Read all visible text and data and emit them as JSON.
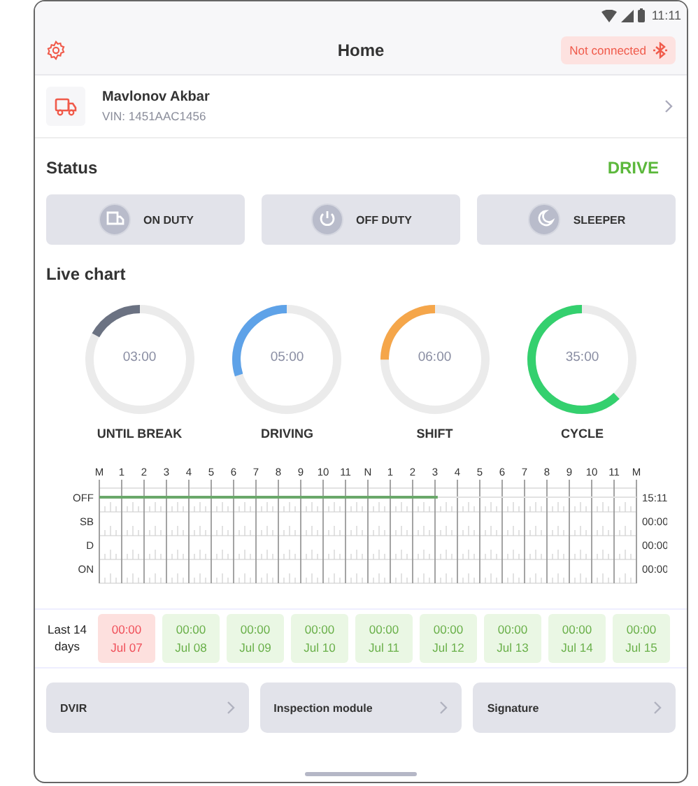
{
  "status_bar": {
    "time": "11:11"
  },
  "header": {
    "title": "Home",
    "connection": {
      "label": "Not connected",
      "connected": false
    }
  },
  "driver": {
    "name": "Mavlonov Akbar",
    "vin": "VIN: 1451AAC1456"
  },
  "status": {
    "title": "Status",
    "current": "DRIVE",
    "buttons": [
      {
        "label": "ON DUTY",
        "selected": false
      },
      {
        "label": "OFF DUTY",
        "selected": false
      },
      {
        "label": "SLEEPER",
        "selected": false
      }
    ]
  },
  "live_chart": {
    "title": "Live chart",
    "gauges": [
      {
        "value": "03:00",
        "label": "UNTIL BREAK",
        "level": 0.17,
        "color": "#6b7282"
      },
      {
        "value": "05:00",
        "label": "DRIVING",
        "level": 0.3,
        "color": "#5ea2e8"
      },
      {
        "value": "06:00",
        "label": "SHIFT",
        "level": 0.25,
        "color": "#f5a64a"
      },
      {
        "value": "35:00",
        "label": "CYCLE",
        "level": 0.62,
        "color": "#34d06e"
      }
    ]
  },
  "log": {
    "hour_labels": [
      "M",
      "1",
      "2",
      "3",
      "4",
      "5",
      "6",
      "7",
      "8",
      "9",
      "10",
      "11",
      "N",
      "1",
      "2",
      "3",
      "4",
      "5",
      "6",
      "7",
      "8",
      "9",
      "10",
      "11",
      "M"
    ],
    "rows": [
      {
        "label": "OFF",
        "total": "15:11",
        "level": 0.63
      },
      {
        "label": "SB",
        "total": "00:00"
      },
      {
        "label": "D",
        "total": "00:00"
      },
      {
        "label": "ON",
        "total": "00:00"
      }
    ]
  },
  "history": {
    "label": "Last 14 days",
    "days": [
      {
        "time": "00:00",
        "date": "Jul 07",
        "kind": "violation"
      },
      {
        "time": "00:00",
        "date": "Jul 08",
        "kind": "ok"
      },
      {
        "time": "00:00",
        "date": "Jul 09",
        "kind": "ok"
      },
      {
        "time": "00:00",
        "date": "Jul 10",
        "kind": "ok"
      },
      {
        "time": "00:00",
        "date": "Jul 11",
        "kind": "ok"
      },
      {
        "time": "00:00",
        "date": "Jul 12",
        "kind": "ok"
      },
      {
        "time": "00:00",
        "date": "Jul 13",
        "kind": "ok"
      },
      {
        "time": "00:00",
        "date": "Jul 14",
        "kind": "ok"
      },
      {
        "time": "00:00",
        "date": "Jul 15",
        "kind": "ok"
      }
    ]
  },
  "links": [
    "DVIR",
    "Inspection module",
    "Signature"
  ]
}
